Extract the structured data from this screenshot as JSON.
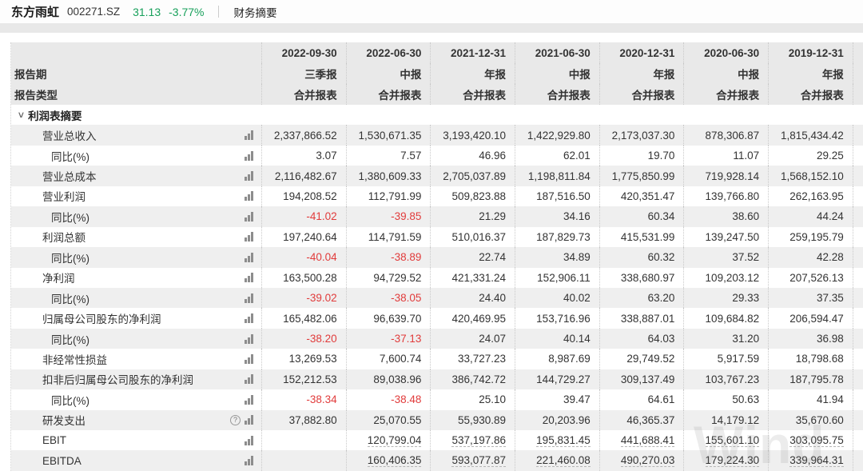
{
  "topbar": {
    "stock_name": "东方雨虹",
    "stock_code": "002271.SZ",
    "price": "31.13",
    "change_percent": "-3.77%",
    "tab_label": "财务摘要"
  },
  "colors": {
    "up_down_green": "#18a05b",
    "negative_red": "#e13b3b",
    "zebra_row": "#efefef",
    "header_bg": "#e9e9e9"
  },
  "watermark": "Wind",
  "table": {
    "corner": {
      "report_period_label": "报告期",
      "report_type_label": "报告类型"
    },
    "columns": [
      {
        "date": "2022-09-30",
        "period": "三季报",
        "scope": "合并报表"
      },
      {
        "date": "2022-06-30",
        "period": "中报",
        "scope": "合并报表"
      },
      {
        "date": "2021-12-31",
        "period": "年报",
        "scope": "合并报表"
      },
      {
        "date": "2021-06-30",
        "period": "中报",
        "scope": "合并报表"
      },
      {
        "date": "2020-12-31",
        "period": "年报",
        "scope": "合并报表"
      },
      {
        "date": "2020-06-30",
        "period": "中报",
        "scope": "合并报表"
      },
      {
        "date": "2019-12-31",
        "period": "年报",
        "scope": "合并报表"
      }
    ],
    "section_label": "利润表摘要",
    "rows": [
      {
        "label": "营业总收入",
        "indent": 1,
        "shade": true,
        "icon": "bar",
        "values": [
          "2,337,866.52",
          "1,530,671.35",
          "3,193,420.10",
          "1,422,929.80",
          "2,173,037.30",
          "878,306.87",
          "1,815,434.42"
        ]
      },
      {
        "label": "同比(%)",
        "indent": 2,
        "shade": false,
        "icon": "bar",
        "values": [
          "3.07",
          "7.57",
          "46.96",
          "62.01",
          "19.70",
          "11.07",
          "29.25"
        ]
      },
      {
        "label": "营业总成本",
        "indent": 1,
        "shade": true,
        "icon": "bar",
        "values": [
          "2,116,482.67",
          "1,380,609.33",
          "2,705,037.89",
          "1,198,811.84",
          "1,775,850.99",
          "719,928.14",
          "1,568,152.10"
        ]
      },
      {
        "label": "营业利润",
        "indent": 1,
        "shade": false,
        "icon": "bar",
        "values": [
          "194,208.52",
          "112,791.99",
          "509,823.88",
          "187,516.50",
          "420,351.47",
          "139,766.80",
          "262,163.95"
        ]
      },
      {
        "label": "同比(%)",
        "indent": 2,
        "shade": true,
        "icon": "bar",
        "values": [
          "-41.02",
          "-39.85",
          "21.29",
          "34.16",
          "60.34",
          "38.60",
          "44.24"
        ]
      },
      {
        "label": "利润总额",
        "indent": 1,
        "shade": false,
        "icon": "bar",
        "values": [
          "197,240.64",
          "114,791.59",
          "510,016.37",
          "187,829.73",
          "415,531.99",
          "139,247.50",
          "259,195.79"
        ]
      },
      {
        "label": "同比(%)",
        "indent": 2,
        "shade": true,
        "icon": "bar",
        "values": [
          "-40.04",
          "-38.89",
          "22.74",
          "34.89",
          "60.32",
          "37.52",
          "42.28"
        ]
      },
      {
        "label": "净利润",
        "indent": 1,
        "shade": false,
        "icon": "bar",
        "values": [
          "163,500.28",
          "94,729.52",
          "421,331.24",
          "152,906.11",
          "338,680.97",
          "109,203.12",
          "207,526.13"
        ]
      },
      {
        "label": "同比(%)",
        "indent": 2,
        "shade": true,
        "icon": "bar",
        "values": [
          "-39.02",
          "-38.05",
          "24.40",
          "40.02",
          "63.20",
          "29.33",
          "37.35"
        ]
      },
      {
        "label": "归属母公司股东的净利润",
        "indent": 1,
        "shade": false,
        "icon": "bar",
        "values": [
          "165,482.06",
          "96,639.70",
          "420,469.95",
          "153,716.96",
          "338,887.01",
          "109,684.82",
          "206,594.47"
        ]
      },
      {
        "label": "同比(%)",
        "indent": 2,
        "shade": true,
        "icon": "bar",
        "values": [
          "-38.20",
          "-37.13",
          "24.07",
          "40.14",
          "64.03",
          "31.20",
          "36.98"
        ]
      },
      {
        "label": "非经常性损益",
        "indent": 1,
        "shade": false,
        "icon": "bar",
        "values": [
          "13,269.53",
          "7,600.74",
          "33,727.23",
          "8,987.69",
          "29,749.52",
          "5,917.59",
          "18,798.68"
        ]
      },
      {
        "label": "扣非后归属母公司股东的净利润",
        "indent": 1,
        "shade": true,
        "icon": "bar",
        "values": [
          "152,212.53",
          "89,038.96",
          "386,742.72",
          "144,729.27",
          "309,137.49",
          "103,767.23",
          "187,795.78"
        ]
      },
      {
        "label": "同比(%)",
        "indent": 2,
        "shade": false,
        "icon": "bar",
        "values": [
          "-38.34",
          "-38.48",
          "25.10",
          "39.47",
          "64.61",
          "50.63",
          "41.94"
        ]
      },
      {
        "label": "研发支出",
        "indent": 1,
        "shade": true,
        "icon": "bar",
        "help": true,
        "values": [
          "37,882.80",
          "25,070.55",
          "55,930.89",
          "20,203.96",
          "46,365.37",
          "14,179.12",
          "35,670.60"
        ]
      },
      {
        "label": "EBIT",
        "indent": 1,
        "shade": false,
        "icon": "bar",
        "underline": true,
        "values": [
          "",
          "120,799.04",
          "537,197.86",
          "195,831.45",
          "441,688.41",
          "155,601.10",
          "303,095.75"
        ]
      },
      {
        "label": "EBITDA",
        "indent": 1,
        "shade": true,
        "icon": "bar",
        "underline": true,
        "values": [
          "",
          "160,406.35",
          "593,077.87",
          "221,460.08",
          "490,270.03",
          "179,224.30",
          "339,964.31"
        ]
      }
    ]
  }
}
